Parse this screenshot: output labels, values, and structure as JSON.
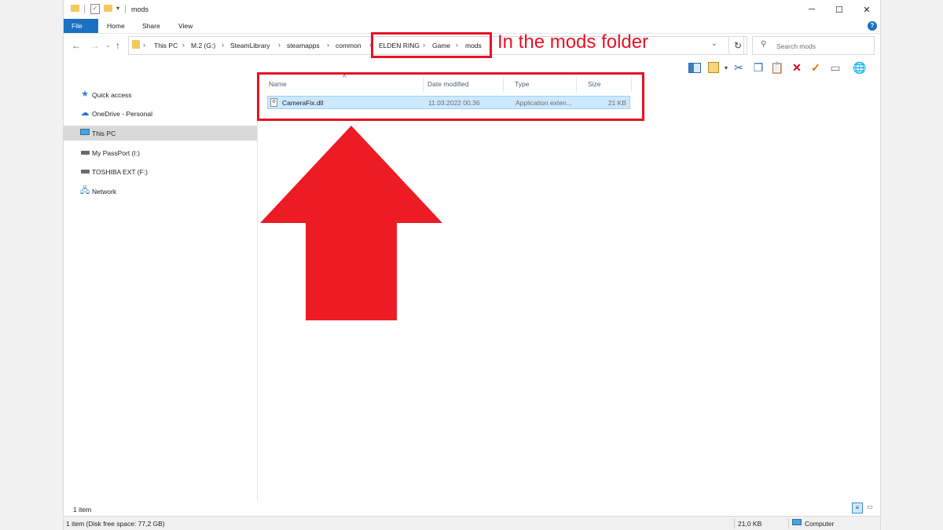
{
  "window": {
    "title": "mods"
  },
  "ribbon": {
    "tabs": [
      "File",
      "Home",
      "Share",
      "View"
    ],
    "help": "?"
  },
  "address": {
    "crumbs": [
      "This PC",
      "M.2 (G:)",
      "SteamLibrary",
      "steamapps",
      "common",
      "ELDEN RING",
      "Game",
      "mods"
    ]
  },
  "search": {
    "placeholder": "Search mods"
  },
  "sidebar": {
    "items": [
      {
        "label": "Quick access",
        "icon": "star-icon"
      },
      {
        "label": "OneDrive - Personal",
        "icon": "cloud-icon"
      },
      {
        "label": "This PC",
        "icon": "computer-icon"
      },
      {
        "label": "My PassPort (I:)",
        "icon": "drive-icon"
      },
      {
        "label": "TOSHIBA EXT (F:)",
        "icon": "drive-icon"
      },
      {
        "label": "Network",
        "icon": "network-icon"
      }
    ]
  },
  "columns": {
    "name": "Name",
    "date": "Date modified",
    "type": "Type",
    "size": "Size"
  },
  "files": [
    {
      "name": "CameraFix.dll",
      "date": "11.03.2022 00.36",
      "type": "Application exten...",
      "size": "21 KB"
    }
  ],
  "status": {
    "items": "1 item",
    "disk": "1 item (Disk free space: 77,2 GB)",
    "size": "21,0 KB",
    "location": "Computer"
  },
  "annotation": {
    "text": "In the mods folder",
    "color": "#e81123"
  },
  "colors": {
    "accent": "#1a70c2",
    "selection": "#cce8ff",
    "annotation": "#e81123"
  }
}
